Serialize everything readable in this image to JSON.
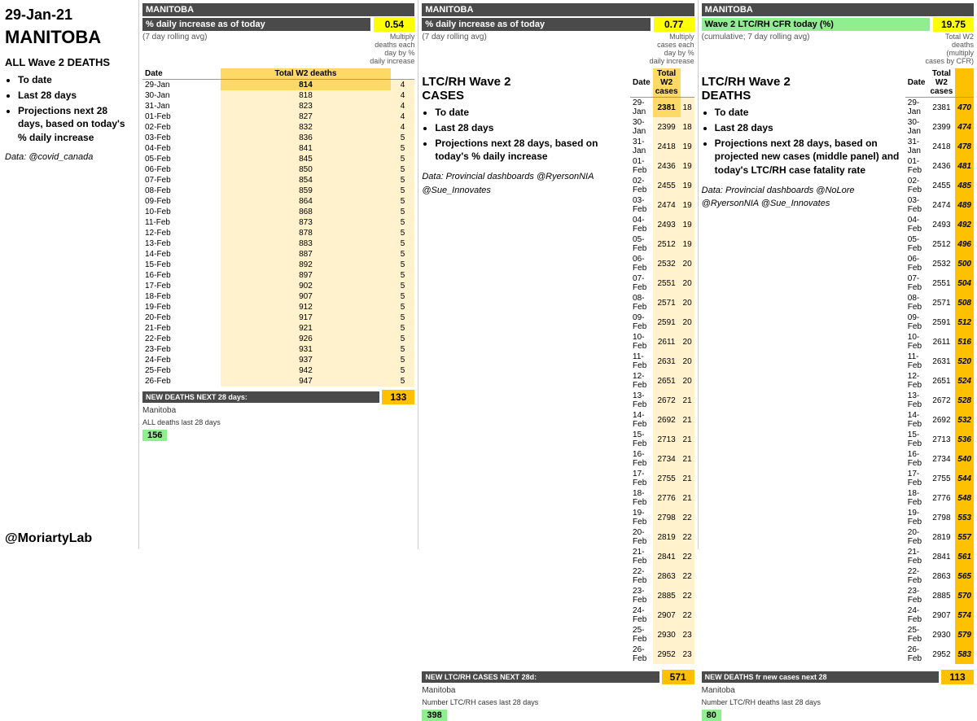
{
  "date": "29-Jan-21",
  "province": "MANITOBA",
  "left": {
    "section_title": "ALL Wave 2 DEATHS",
    "bullets": [
      "To date",
      "Last 28 days",
      "Projections next 28 days, based on today's % daily increase"
    ],
    "data_credit": "Data: @covid_canada"
  },
  "bottom_credit": "@MoriartyLab",
  "panel1": {
    "province": "MANITOBA",
    "metric_label": "% daily increase as of today",
    "metric_value": "0.54",
    "sub_label": "(7 day rolling avg)",
    "multiply_label": "Multiply deaths each day by % daily increase",
    "col1": "Date",
    "col2": "Total W2 deaths",
    "col3": "",
    "rows": [
      {
        "date": "29-Jan",
        "val": 814,
        "inc": 4
      },
      {
        "date": "30-Jan",
        "val": 818,
        "inc": 4
      },
      {
        "date": "31-Jan",
        "val": 823,
        "inc": 4
      },
      {
        "date": "01-Feb",
        "val": 827,
        "inc": 4
      },
      {
        "date": "02-Feb",
        "val": 832,
        "inc": 4
      },
      {
        "date": "03-Feb",
        "val": 836,
        "inc": 5
      },
      {
        "date": "04-Feb",
        "val": 841,
        "inc": 5
      },
      {
        "date": "05-Feb",
        "val": 845,
        "inc": 5
      },
      {
        "date": "06-Feb",
        "val": 850,
        "inc": 5
      },
      {
        "date": "07-Feb",
        "val": 854,
        "inc": 5
      },
      {
        "date": "08-Feb",
        "val": 859,
        "inc": 5
      },
      {
        "date": "09-Feb",
        "val": 864,
        "inc": 5
      },
      {
        "date": "10-Feb",
        "val": 868,
        "inc": 5
      },
      {
        "date": "11-Feb",
        "val": 873,
        "inc": 5
      },
      {
        "date": "12-Feb",
        "val": 878,
        "inc": 5
      },
      {
        "date": "13-Feb",
        "val": 883,
        "inc": 5
      },
      {
        "date": "14-Feb",
        "val": 887,
        "inc": 5
      },
      {
        "date": "15-Feb",
        "val": 892,
        "inc": 5
      },
      {
        "date": "16-Feb",
        "val": 897,
        "inc": 5
      },
      {
        "date": "17-Feb",
        "val": 902,
        "inc": 5
      },
      {
        "date": "18-Feb",
        "val": 907,
        "inc": 5
      },
      {
        "date": "19-Feb",
        "val": 912,
        "inc": 5
      },
      {
        "date": "20-Feb",
        "val": 917,
        "inc": 5
      },
      {
        "date": "21-Feb",
        "val": 921,
        "inc": 5
      },
      {
        "date": "22-Feb",
        "val": 926,
        "inc": 5
      },
      {
        "date": "23-Feb",
        "val": 931,
        "inc": 5
      },
      {
        "date": "24-Feb",
        "val": 937,
        "inc": 5
      },
      {
        "date": "25-Feb",
        "val": 942,
        "inc": 5
      },
      {
        "date": "26-Feb",
        "val": 947,
        "inc": 5
      }
    ],
    "summary_label": "NEW DEATHS NEXT 28 days:",
    "summary_value": "133",
    "summary_province": "Manitoba",
    "total_label": "ALL deaths last 28 days",
    "total_value": "156"
  },
  "panel2": {
    "province": "MANITOBA",
    "metric_label": "% daily increase as of today",
    "metric_value": "0.77",
    "sub_label": "(7 day rolling avg)",
    "multiply_label": "Multiply cases each day by % daily increase",
    "section_title": "LTC/RH Wave 2 CASES",
    "bullets": [
      "To date",
      "Last 28 days",
      "Projections next 28 days, based on today's % daily increase"
    ],
    "data_credit": "Data: Provincial dashboards @RyersonNIA @Sue_Innovates",
    "col1": "Date",
    "col2": "Total W2 cases",
    "col3": "",
    "rows": [
      {
        "date": "29-Jan",
        "val": 2381,
        "inc": 18
      },
      {
        "date": "30-Jan",
        "val": 2399,
        "inc": 18
      },
      {
        "date": "31-Jan",
        "val": 2418,
        "inc": 19
      },
      {
        "date": "01-Feb",
        "val": 2436,
        "inc": 19
      },
      {
        "date": "02-Feb",
        "val": 2455,
        "inc": 19
      },
      {
        "date": "03-Feb",
        "val": 2474,
        "inc": 19
      },
      {
        "date": "04-Feb",
        "val": 2493,
        "inc": 19
      },
      {
        "date": "05-Feb",
        "val": 2512,
        "inc": 19
      },
      {
        "date": "06-Feb",
        "val": 2532,
        "inc": 20
      },
      {
        "date": "07-Feb",
        "val": 2551,
        "inc": 20
      },
      {
        "date": "08-Feb",
        "val": 2571,
        "inc": 20
      },
      {
        "date": "09-Feb",
        "val": 2591,
        "inc": 20
      },
      {
        "date": "10-Feb",
        "val": 2611,
        "inc": 20
      },
      {
        "date": "11-Feb",
        "val": 2631,
        "inc": 20
      },
      {
        "date": "12-Feb",
        "val": 2651,
        "inc": 20
      },
      {
        "date": "13-Feb",
        "val": 2672,
        "inc": 21
      },
      {
        "date": "14-Feb",
        "val": 2692,
        "inc": 21
      },
      {
        "date": "15-Feb",
        "val": 2713,
        "inc": 21
      },
      {
        "date": "16-Feb",
        "val": 2734,
        "inc": 21
      },
      {
        "date": "17-Feb",
        "val": 2755,
        "inc": 21
      },
      {
        "date": "18-Feb",
        "val": 2776,
        "inc": 21
      },
      {
        "date": "19-Feb",
        "val": 2798,
        "inc": 22
      },
      {
        "date": "20-Feb",
        "val": 2819,
        "inc": 22
      },
      {
        "date": "21-Feb",
        "val": 2841,
        "inc": 22
      },
      {
        "date": "22-Feb",
        "val": 2863,
        "inc": 22
      },
      {
        "date": "23-Feb",
        "val": 2885,
        "inc": 22
      },
      {
        "date": "24-Feb",
        "val": 2907,
        "inc": 22
      },
      {
        "date": "25-Feb",
        "val": 2930,
        "inc": 23
      },
      {
        "date": "26-Feb",
        "val": 2952,
        "inc": 23
      }
    ],
    "summary_label": "NEW LTC/RH CASES NEXT 28d:",
    "summary_value": "571",
    "summary_province": "Manitoba",
    "total_label": "Number LTC/RH cases last 28 days",
    "total_value": "398"
  },
  "panel3": {
    "province": "MANITOBA",
    "metric_label": "Wave 2 LTC/RH CFR today (%)",
    "metric_value": "19.75",
    "sub_label": "(cumulative; 7 day rolling avg)",
    "section_title": "LTC/RH Wave 2 DEATHS",
    "bullets": [
      "To date",
      "Last 28 days",
      "Projections next 28 days, based on projected new cases (middle panel) and today's LTC/RH case fatality rate"
    ],
    "data_credit": "Data: Provincial dashboards @NoLore @RyersonNIA @Sue_Innovates",
    "col1": "Date",
    "col2": "Total W2 cases",
    "col3": "Total W2 deaths (multiply cases by CFR)",
    "rows": [
      {
        "date": "29-Jan",
        "val": 2381,
        "deaths": 470
      },
      {
        "date": "30-Jan",
        "val": 2399,
        "deaths": 474
      },
      {
        "date": "31-Jan",
        "val": 2418,
        "deaths": 478
      },
      {
        "date": "01-Feb",
        "val": 2436,
        "deaths": 481
      },
      {
        "date": "02-Feb",
        "val": 2455,
        "deaths": 485
      },
      {
        "date": "03-Feb",
        "val": 2474,
        "deaths": 489
      },
      {
        "date": "04-Feb",
        "val": 2493,
        "deaths": 492
      },
      {
        "date": "05-Feb",
        "val": 2512,
        "deaths": 496
      },
      {
        "date": "06-Feb",
        "val": 2532,
        "deaths": 500
      },
      {
        "date": "07-Feb",
        "val": 2551,
        "deaths": 504
      },
      {
        "date": "08-Feb",
        "val": 2571,
        "deaths": 508
      },
      {
        "date": "09-Feb",
        "val": 2591,
        "deaths": 512
      },
      {
        "date": "10-Feb",
        "val": 2611,
        "deaths": 516
      },
      {
        "date": "11-Feb",
        "val": 2631,
        "deaths": 520
      },
      {
        "date": "12-Feb",
        "val": 2651,
        "deaths": 524
      },
      {
        "date": "13-Feb",
        "val": 2672,
        "deaths": 528
      },
      {
        "date": "14-Feb",
        "val": 2692,
        "deaths": 532
      },
      {
        "date": "15-Feb",
        "val": 2713,
        "deaths": 536
      },
      {
        "date": "16-Feb",
        "val": 2734,
        "deaths": 540
      },
      {
        "date": "17-Feb",
        "val": 2755,
        "deaths": 544
      },
      {
        "date": "18-Feb",
        "val": 2776,
        "deaths": 548
      },
      {
        "date": "19-Feb",
        "val": 2798,
        "deaths": 553
      },
      {
        "date": "20-Feb",
        "val": 2819,
        "deaths": 557
      },
      {
        "date": "21-Feb",
        "val": 2841,
        "deaths": 561
      },
      {
        "date": "22-Feb",
        "val": 2863,
        "deaths": 565
      },
      {
        "date": "23-Feb",
        "val": 2885,
        "deaths": 570
      },
      {
        "date": "24-Feb",
        "val": 2907,
        "deaths": 574
      },
      {
        "date": "25-Feb",
        "val": 2930,
        "deaths": 579
      },
      {
        "date": "26-Feb",
        "val": 2952,
        "deaths": 583
      }
    ],
    "summary_label": "NEW DEATHS fr new cases next 28",
    "summary_value": "113",
    "summary_province": "Manitoba",
    "total_label": "Number LTC/RH deaths last 28 days",
    "total_value": "80"
  }
}
